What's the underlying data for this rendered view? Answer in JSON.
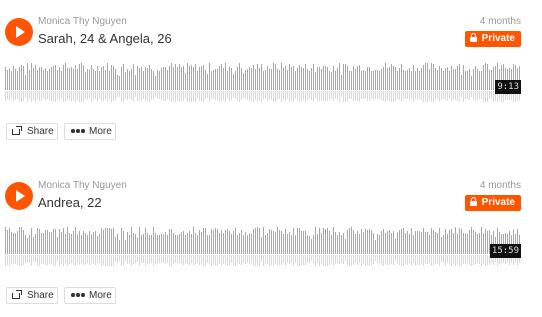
{
  "colors": {
    "accent": "#ff5500",
    "waveform_bar": "#a8a8a8",
    "waveform_reflection": "#d9d9d9",
    "duration_bg": "#111111"
  },
  "tracks": [
    {
      "username": "Monica Thy Nguyen",
      "title": "Sarah, 24 & Angela, 26",
      "time_ago": "4 months",
      "privacy_label": "Private",
      "duration": "9:13",
      "share_label": "Share",
      "more_label": "More"
    },
    {
      "username": "Monica Thy Nguyen",
      "title": "Andrea, 22",
      "time_ago": "4 months",
      "privacy_label": "Private",
      "duration": "15:59",
      "share_label": "Share",
      "more_label": "More"
    }
  ]
}
